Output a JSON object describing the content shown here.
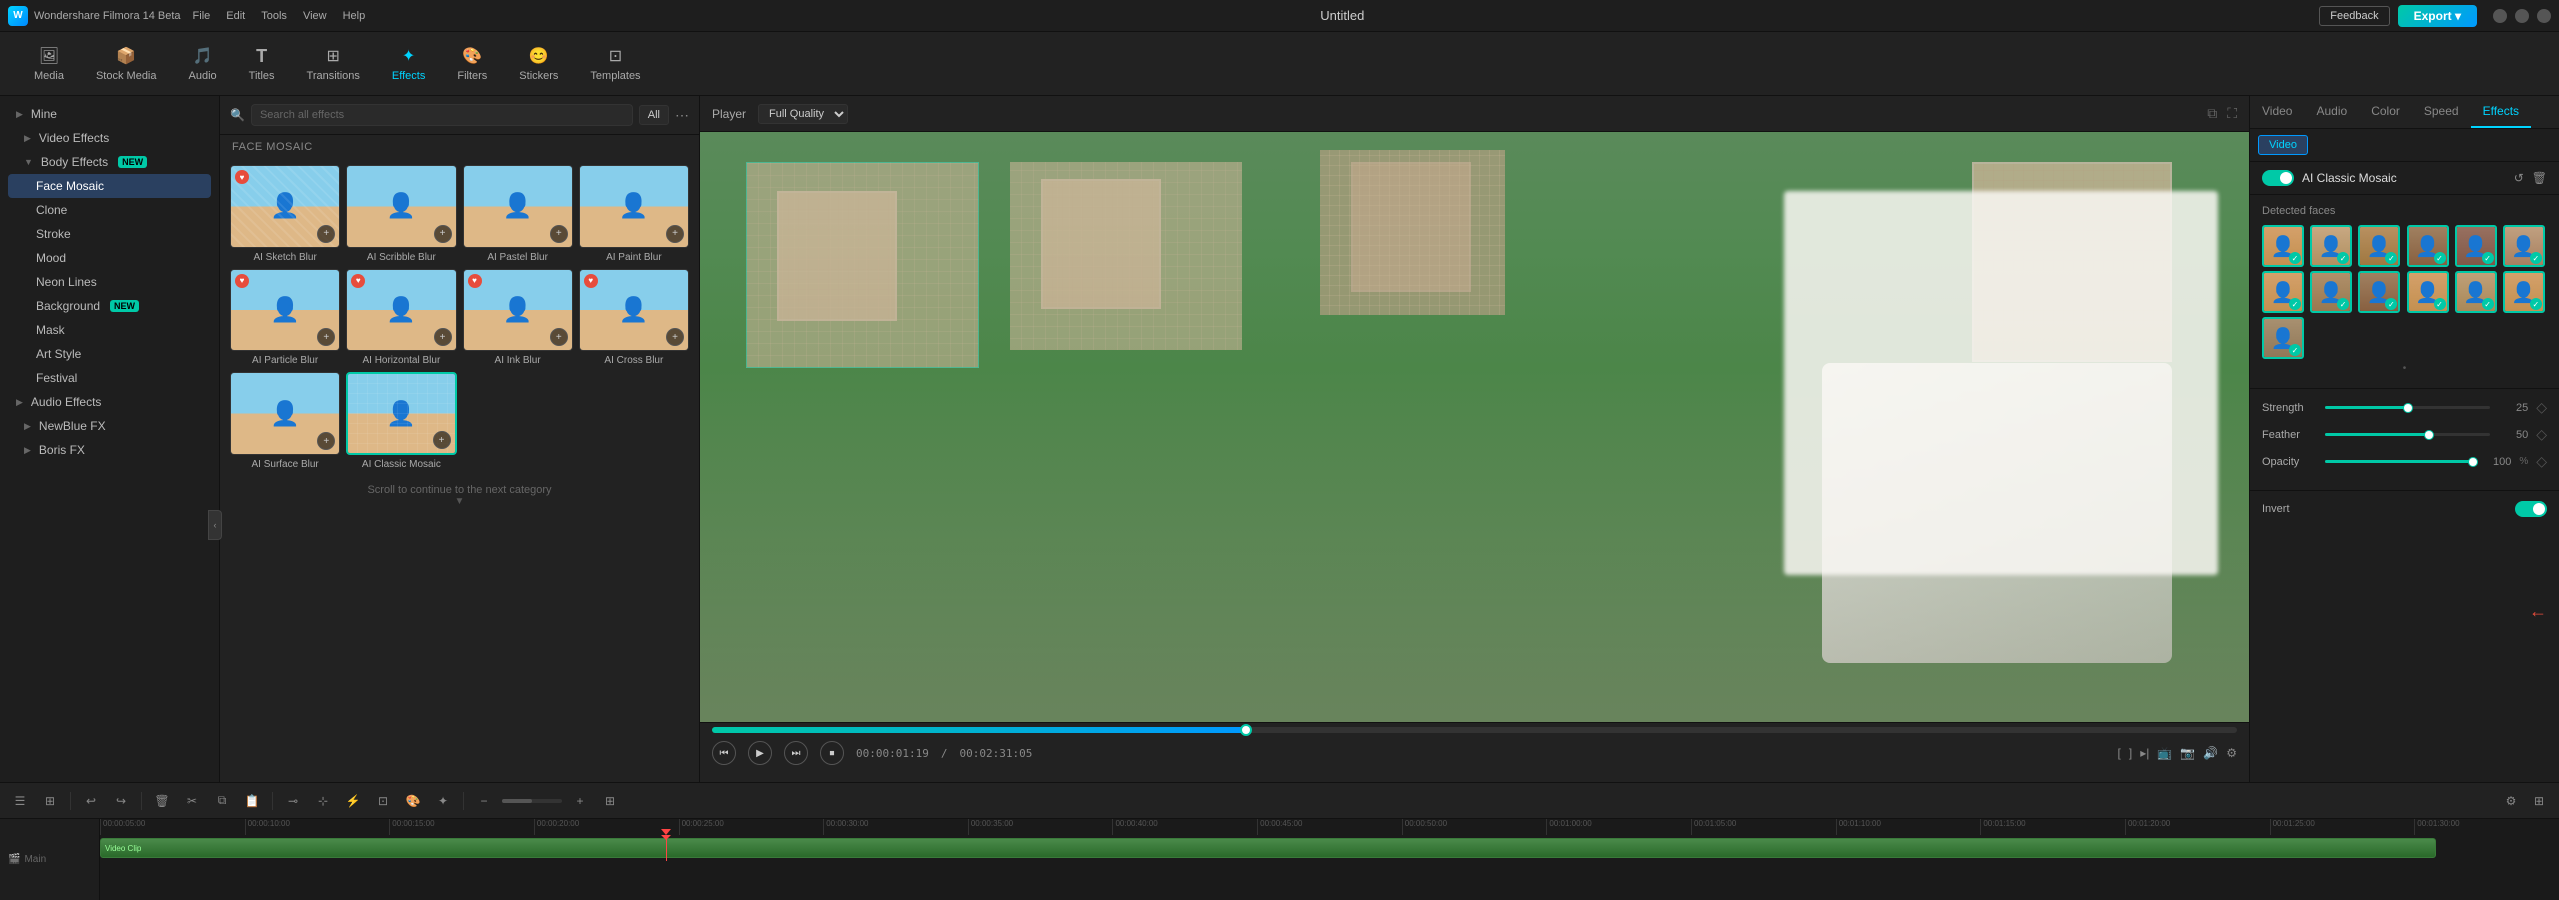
{
  "app": {
    "title": "Wondershare Filmora 14 Beta",
    "document_title": "Untitled"
  },
  "titlebar": {
    "menu_items": [
      "File",
      "Edit",
      "Tools",
      "View",
      "Help"
    ],
    "feedback_label": "Feedback",
    "export_label": "Export ▾"
  },
  "toolbar": {
    "items": [
      {
        "id": "media",
        "label": "Media",
        "icon": "🖼"
      },
      {
        "id": "stock",
        "label": "Stock Media",
        "icon": "📦"
      },
      {
        "id": "audio",
        "label": "Audio",
        "icon": "🎵"
      },
      {
        "id": "titles",
        "label": "Titles",
        "icon": "T"
      },
      {
        "id": "transitions",
        "label": "Transitions",
        "icon": "⊞"
      },
      {
        "id": "effects",
        "label": "Effects",
        "icon": "✦",
        "active": true
      },
      {
        "id": "filters",
        "label": "Filters",
        "icon": "🎨"
      },
      {
        "id": "stickers",
        "label": "Stickers",
        "icon": "😊"
      },
      {
        "id": "templates",
        "label": "Templates",
        "icon": "⊡"
      }
    ]
  },
  "left_panel": {
    "sections": [
      {
        "id": "mine",
        "label": "Mine",
        "arrow": "▶",
        "indent": 0
      },
      {
        "id": "video_effects",
        "label": "Video Effects",
        "arrow": "▶",
        "indent": 1
      },
      {
        "id": "body_effects",
        "label": "Body Effects",
        "arrow": "▼",
        "indent": 1,
        "badge": "NEW"
      },
      {
        "id": "face_mosaic",
        "label": "Face Mosaic",
        "indent": 2,
        "active": true
      },
      {
        "id": "clone",
        "label": "Clone",
        "indent": 2
      },
      {
        "id": "stroke",
        "label": "Stroke",
        "indent": 2
      },
      {
        "id": "mood",
        "label": "Mood",
        "indent": 2
      },
      {
        "id": "neon_lines",
        "label": "Neon Lines",
        "indent": 2
      },
      {
        "id": "background",
        "label": "Background",
        "indent": 2,
        "badge": "NEW"
      },
      {
        "id": "mask",
        "label": "Mask",
        "indent": 2
      },
      {
        "id": "art_style",
        "label": "Art Style",
        "indent": 2
      },
      {
        "id": "festival",
        "label": "Festival",
        "indent": 2
      },
      {
        "id": "audio_effects",
        "label": "Audio Effects",
        "arrow": "▶",
        "indent": 0
      },
      {
        "id": "newblue_fx",
        "label": "NewBlue FX",
        "arrow": "▶",
        "indent": 1
      },
      {
        "id": "boris_fx",
        "label": "Boris FX",
        "arrow": "▶",
        "indent": 1
      }
    ]
  },
  "effects_panel": {
    "search_placeholder": "Search all effects",
    "category": "FACE MOSAIC",
    "filter_label": "All",
    "effects": [
      {
        "id": "ai_sketch_blur",
        "label": "AI Sketch Blur"
      },
      {
        "id": "ai_scribble_blur",
        "label": "AI Scribble Blur"
      },
      {
        "id": "ai_pastel_blur",
        "label": "AI Pastel Blur"
      },
      {
        "id": "ai_paint_blur",
        "label": "AI Paint Blur"
      },
      {
        "id": "ai_particle_blur",
        "label": "AI Particle Blur"
      },
      {
        "id": "ai_horizontal_blur",
        "label": "AI Horizontal Blur"
      },
      {
        "id": "ai_ink_blur",
        "label": "AI Ink Blur"
      },
      {
        "id": "ai_cross_blur",
        "label": "AI Cross Blur"
      },
      {
        "id": "ai_surface_blur",
        "label": "AI Surface Blur"
      },
      {
        "id": "ai_classic_mosaic",
        "label": "AI Classic Mosaic",
        "selected": true
      }
    ],
    "scroll_hint": "Scroll to continue to the next category"
  },
  "preview": {
    "label": "Player",
    "quality": "Full Quality",
    "timecode_current": "00:00:01:19",
    "timecode_total": "00:02:31:05"
  },
  "right_panel": {
    "tabs": [
      "Video",
      "Audio",
      "Color",
      "Speed",
      "Effects"
    ],
    "active_tab": "Effects",
    "sub_tabs": [
      "Video"
    ],
    "active_sub_tab": "Video",
    "effect_name": "AI Classic Mosaic",
    "detected_faces_label": "Detected faces",
    "faces": [
      {
        "id": 1,
        "selected": true
      },
      {
        "id": 2,
        "selected": true
      },
      {
        "id": 3,
        "selected": true
      },
      {
        "id": 4,
        "selected": true
      },
      {
        "id": 5,
        "selected": true
      },
      {
        "id": 6,
        "selected": true
      },
      {
        "id": 7,
        "selected": true
      },
      {
        "id": 8,
        "selected": true
      },
      {
        "id": 9,
        "selected": true
      },
      {
        "id": 10,
        "selected": true
      },
      {
        "id": 11,
        "selected": true
      },
      {
        "id": 12,
        "selected": true
      },
      {
        "id": 13,
        "selected": true
      }
    ],
    "sliders": [
      {
        "id": "strength",
        "label": "Strength",
        "value": 25,
        "fill_pct": 50
      },
      {
        "id": "feather",
        "label": "Feather",
        "value": 50,
        "fill_pct": 63
      },
      {
        "id": "opacity",
        "label": "Opacity",
        "value": 100,
        "fill_pct": 100
      }
    ],
    "invert": {
      "label": "Invert",
      "value": true
    }
  },
  "timeline": {
    "toolbar_actions": [
      "undo",
      "redo",
      "cut",
      "delete",
      "split",
      "crop",
      "speed",
      "audio",
      "color",
      "remove_bg",
      "mosaic",
      "zoom_in",
      "zoom_out"
    ],
    "time_marks": [
      "00:00:05:00",
      "00:00:10:00",
      "00:00:15:00",
      "00:00:20:00",
      "00:00:25:00",
      "00:00:30:00",
      "00:00:35:00",
      "00:00:40:00",
      "00:00:45:00",
      "00:00:50:00",
      "00:01:00:00",
      "00:01:05:00",
      "00:01:10:00",
      "00:01:15:00",
      "00:01:20:00",
      "00:01:25:00",
      "00:01:30:00"
    ]
  }
}
